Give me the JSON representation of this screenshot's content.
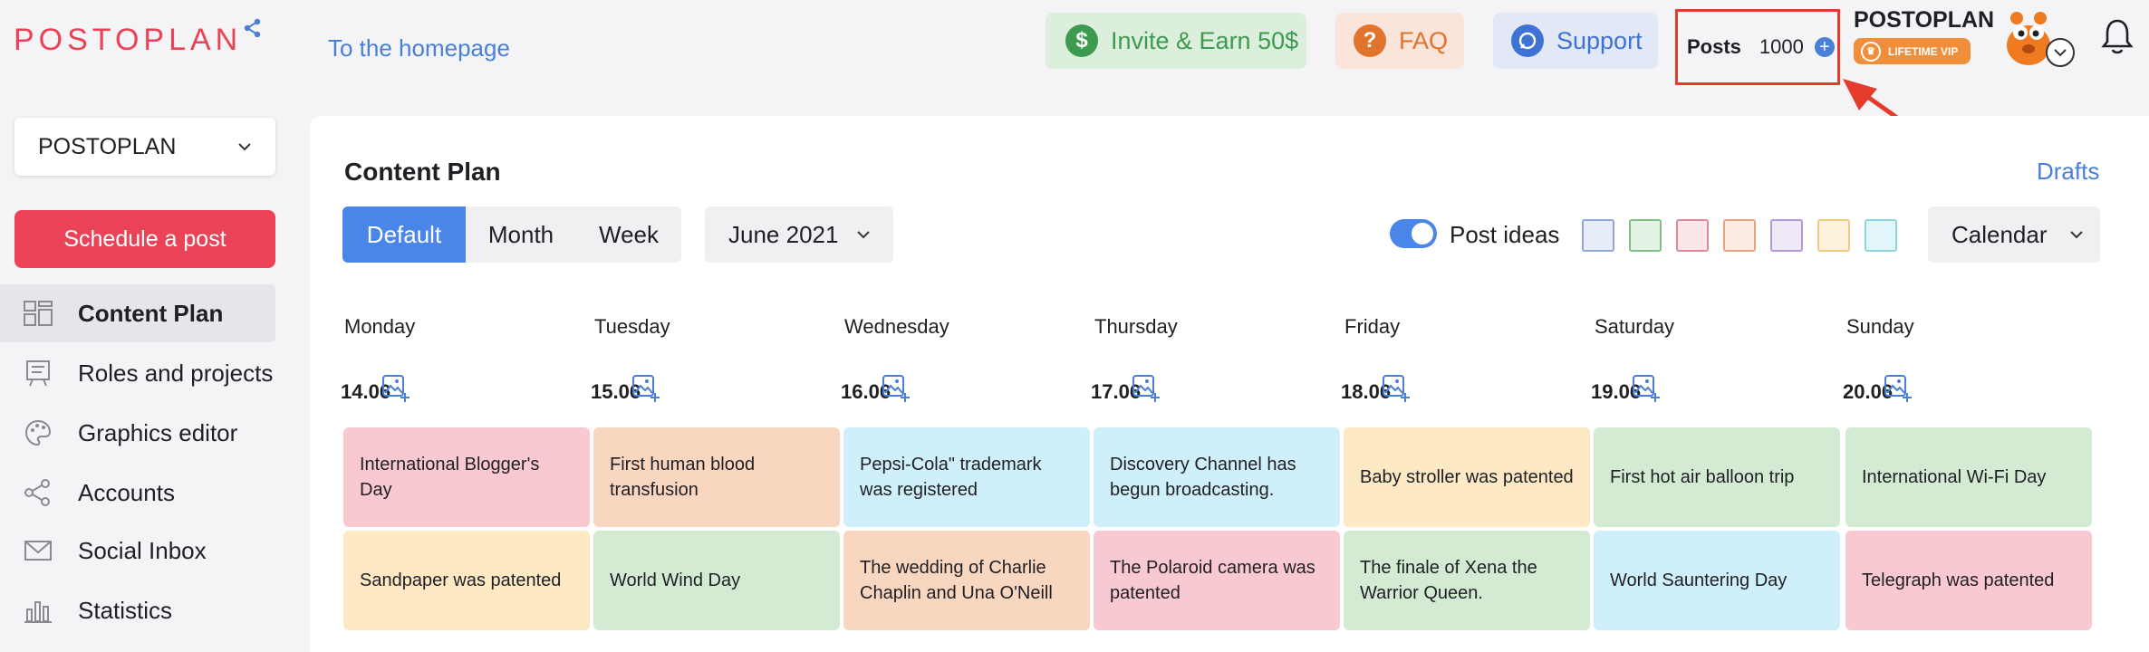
{
  "header": {
    "logo": "POSTOPLAN",
    "home_link": "To the homepage",
    "invite": {
      "label": "Invite & Earn 50$",
      "icon": "dollar-icon"
    },
    "faq": {
      "label": "FAQ",
      "icon": "question-icon"
    },
    "support": {
      "label": "Support",
      "icon": "chat-icon"
    },
    "posts": {
      "label": "Posts",
      "count": "1000"
    },
    "account": {
      "name": "POSTOPLAN",
      "badge": "LIFETIME VIP"
    }
  },
  "sidebar": {
    "project": "POSTOPLAN",
    "schedule_button": "Schedule a post",
    "items": [
      {
        "label": "Content Plan",
        "icon": "grid-icon",
        "active": true
      },
      {
        "label": "Roles and projects",
        "icon": "board-icon"
      },
      {
        "label": "Graphics editor",
        "icon": "palette-icon"
      },
      {
        "label": "Accounts",
        "icon": "share-icon"
      },
      {
        "label": "Social Inbox",
        "icon": "envelope-icon"
      },
      {
        "label": "Statistics",
        "icon": "bar-chart-icon"
      }
    ]
  },
  "main": {
    "title": "Content Plan",
    "drafts": "Drafts",
    "views": [
      "Default",
      "Month",
      "Week"
    ],
    "active_view": "Default",
    "month": "June 2021",
    "post_ideas_label": "Post ideas",
    "post_ideas_on": true,
    "swatches": [
      {
        "border": "#8ea6dc",
        "fill": "#e6ecf8"
      },
      {
        "border": "#7fbf86",
        "fill": "#e5f3e6"
      },
      {
        "border": "#e1899a",
        "fill": "#fbe6ea"
      },
      {
        "border": "#e9a27b",
        "fill": "#fcebe2"
      },
      {
        "border": "#b69ad6",
        "fill": "#f0e9f8"
      },
      {
        "border": "#ecca7e",
        "fill": "#fdf3dd"
      },
      {
        "border": "#8ad7e0",
        "fill": "#e3f7fa"
      }
    ],
    "view_select": "Calendar",
    "days": [
      {
        "name": "Monday",
        "date": "14.06",
        "posts": [
          {
            "text": "International Blogger's Day",
            "color": "#f9c9d1"
          },
          {
            "text": "Sandpaper was patented",
            "color": "#fde9c4"
          }
        ]
      },
      {
        "name": "Tuesday",
        "date": "15.06",
        "posts": [
          {
            "text": "First human blood transfusion",
            "color": "#f9d6c0"
          },
          {
            "text": "World Wind Day",
            "color": "#d3ebd3"
          }
        ]
      },
      {
        "name": "Wednesday",
        "date": "16.06",
        "posts": [
          {
            "text": "Pepsi-Cola\" trademark was registered",
            "color": "#cfeffa"
          },
          {
            "text": "The wedding of Charlie Chaplin and Una O'Neill",
            "color": "#f9d6c0"
          }
        ]
      },
      {
        "name": "Thursday",
        "date": "17.06",
        "posts": [
          {
            "text": "Discovery Channel has begun broadcasting.",
            "color": "#cfeffa"
          },
          {
            "text": "The Polaroid camera was patented",
            "color": "#f9c9d1"
          }
        ]
      },
      {
        "name": "Friday",
        "date": "18.06",
        "posts": [
          {
            "text": "Baby stroller was patented",
            "color": "#fde9c4"
          },
          {
            "text": "The finale of Xena the Warrior Queen.",
            "color": "#d3ebd3"
          }
        ]
      },
      {
        "name": "Saturday",
        "date": "19.06",
        "posts": [
          {
            "text": "First hot air balloon trip",
            "color": "#d3ebd3"
          },
          {
            "text": "World Sauntering Day",
            "color": "#cfeffa"
          }
        ]
      },
      {
        "name": "Sunday",
        "date": "20.06",
        "posts": [
          {
            "text": "International Wi-Fi Day",
            "color": "#d3ebd3"
          },
          {
            "text": "Telegraph was patented",
            "color": "#f9c9d1"
          }
        ]
      }
    ]
  }
}
